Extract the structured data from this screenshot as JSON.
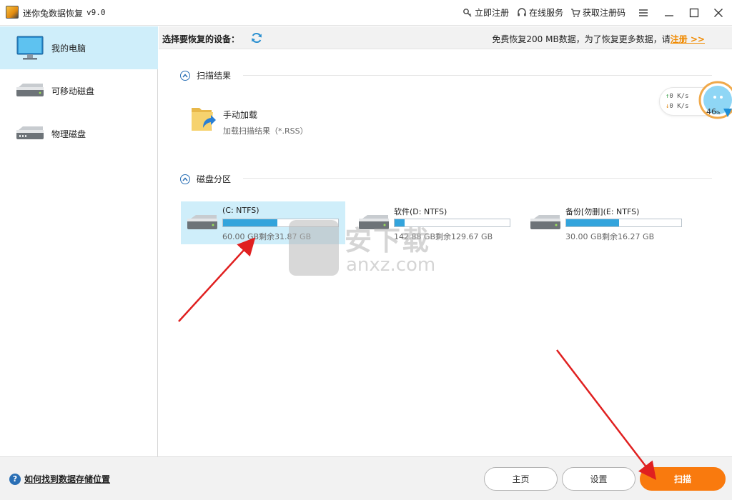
{
  "window": {
    "title": "迷你兔数据恢复",
    "version": "v9.0",
    "links": [
      {
        "label": "立即注册",
        "icon": "key-icon"
      },
      {
        "label": "在线服务",
        "icon": "headset-icon"
      },
      {
        "label": "获取注册码",
        "icon": "cart-icon"
      }
    ]
  },
  "sidebar": {
    "items": [
      {
        "label": "我的电脑",
        "icon": "monitor-icon",
        "active": true
      },
      {
        "label": "可移动磁盘",
        "icon": "removable-disk-icon",
        "active": false
      },
      {
        "label": "物理磁盘",
        "icon": "physical-disk-icon",
        "active": false
      }
    ]
  },
  "device_bar": {
    "label": "选择要恢复的设备：",
    "promo_text": "免费恢复200 MB数据，为了恢复更多数据，请",
    "promo_link": "注册 >>"
  },
  "scan_results": {
    "title": "扫描结果",
    "manual": {
      "name": "手动加载",
      "desc": "加载扫描结果（*.RSS）"
    }
  },
  "partitions": {
    "title": "磁盘分区",
    "items": [
      {
        "name": "(C: NTFS)",
        "info": "60.00 GB剩余31.87 GB",
        "used_fraction": 0.47,
        "selected": true
      },
      {
        "name": "软件(D: NTFS)",
        "info": "142.88 GB剩余129.67 GB",
        "used_fraction": 0.09,
        "selected": false
      },
      {
        "name": "备份[勿删](E: NTFS)",
        "info": "30.00 GB剩余16.27 GB",
        "used_fraction": 0.46,
        "selected": false
      }
    ]
  },
  "speed_widget": {
    "up": "0  K/s",
    "down": "0  K/s",
    "percent": "46",
    "percent_unit": "%"
  },
  "watermark": {
    "big": "安下载",
    "small": "anxz.com"
  },
  "bottom": {
    "help": "如何找到数据存储位置",
    "home": "主页",
    "settings": "设置",
    "scan": "扫描"
  },
  "colors": {
    "accent": "#f97a0e",
    "selected_bg": "#cfeefa",
    "bar_fill": "#33a4dc",
    "link": "#f08a00"
  }
}
